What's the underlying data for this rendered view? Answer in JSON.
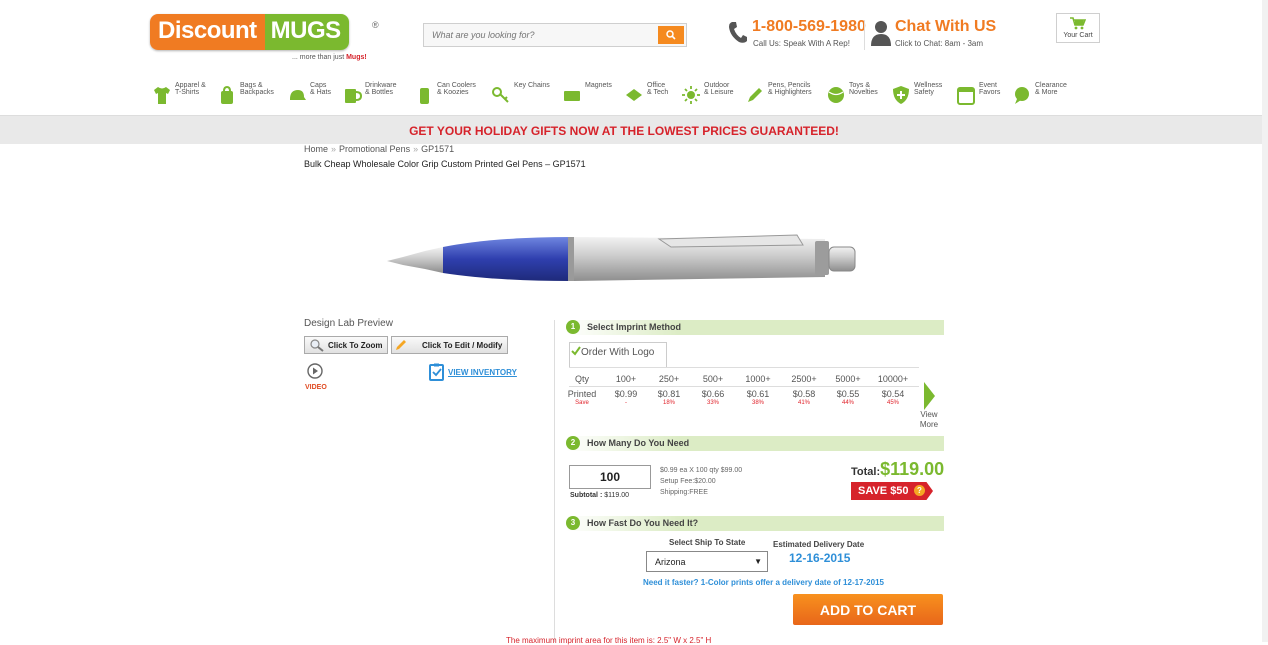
{
  "header": {
    "logo": {
      "part1": "Discount",
      "part2": "MUGS",
      "reg": "®",
      "tagline_prefix": "... more than just ",
      "tagline_emph": "Mugs!"
    },
    "search": {
      "placeholder": "What are you looking for?"
    },
    "phone": {
      "number": "1-800-569-1980",
      "sub": "Call Us: Speak With A Rep!"
    },
    "chat": {
      "title": "Chat With US",
      "sub": "Click to Chat: 8am - 3am"
    },
    "cart": {
      "label": "Your Cart"
    }
  },
  "nav": {
    "items": [
      {
        "label": "Apparel &\nT-Shirts",
        "icon": "tshirt-icon"
      },
      {
        "label": "Bags &\nBackpacks",
        "icon": "bag-icon"
      },
      {
        "label": "Caps\n& Hats",
        "icon": "cap-icon"
      },
      {
        "label": "Drinkware\n& Bottles",
        "icon": "mug-icon"
      },
      {
        "label": "Can Coolers\n& Koozies",
        "icon": "can-icon"
      },
      {
        "label": "Key Chains",
        "icon": "keychain-icon"
      },
      {
        "label": "Magnets",
        "icon": "magnet-icon"
      },
      {
        "label": "Office\n& Tech",
        "icon": "office-icon"
      },
      {
        "label": "Outdoor\n& Leisure",
        "icon": "sun-icon"
      },
      {
        "label": "Pens, Pencils\n& Highlighters",
        "icon": "pen-icon"
      },
      {
        "label": "Toys &\nNovelties",
        "icon": "ball-icon"
      },
      {
        "label": "Wellness\nSafety",
        "icon": "shield-icon"
      },
      {
        "label": "Event\nFavors",
        "icon": "calendar-icon"
      },
      {
        "label": "Clearance\n& More",
        "icon": "chat-bubble-icon"
      }
    ]
  },
  "banner": {
    "text": "GET YOUR HOLIDAY GIFTS NOW AT THE LOWEST PRICES GUARANTEED!"
  },
  "breadcrumb": {
    "home": "Home",
    "category": "Promotional Pens",
    "current": "GP1571"
  },
  "product": {
    "title": "Bulk Cheap Wholesale Color Grip Custom Printed Gel Pens – GP1571"
  },
  "tools": {
    "design_lab": "Design Lab Preview",
    "zoom": "Click To Zoom",
    "edit": "Click To Edit / Modify",
    "video": "VIDEO",
    "inventory": "VIEW INVENTORY"
  },
  "step1": {
    "num": "1",
    "title": "Select Imprint Method",
    "tab": "Order With Logo"
  },
  "pricing": {
    "row_labels": {
      "qty": "Qty",
      "price": "Printed",
      "save": "Save"
    },
    "tiers": [
      {
        "qty": "100+",
        "price": "$0.99",
        "save": "-"
      },
      {
        "qty": "250+",
        "price": "$0.81",
        "save": "18%"
      },
      {
        "qty": "500+",
        "price": "$0.66",
        "save": "33%"
      },
      {
        "qty": "1000+",
        "price": "$0.61",
        "save": "38%"
      },
      {
        "qty": "2500+",
        "price": "$0.58",
        "save": "41%"
      },
      {
        "qty": "5000+",
        "price": "$0.55",
        "save": "44%"
      },
      {
        "qty": "10000+",
        "price": "$0.54",
        "save": "45%"
      }
    ],
    "view_more": "View More"
  },
  "step2": {
    "num": "2",
    "title": "How Many Do You Need",
    "qty": "100",
    "subtotal_label": "Subtotal :",
    "subtotal_value": "$119.00",
    "calc1": "$0.99 ea X 100 qty $99.00",
    "calc2": "Setup Fee:$20.00",
    "calc3": "Shipping:FREE",
    "total_label": "Total:",
    "total_value": "$119.00",
    "save_badge": "SAVE $50",
    "save_q": "?"
  },
  "step3": {
    "num": "3",
    "title": "How Fast Do You Need It?",
    "ship_label": "Select Ship To State",
    "state": "Arizona",
    "est_label": "Estimated Delivery Date",
    "est_date": "12-16-2015",
    "faster": "Need it faster? 1-Color prints offer a delivery date of 12-17-2015"
  },
  "add_to_cart": "ADD TO CART",
  "imprint_note": "The maximum imprint area for this item is: 2.5\" W x 2.5\" H",
  "colors": {
    "orange": "#f07b22",
    "green": "#7bb92f",
    "red": "#d6232b",
    "blue": "#2e8fd8"
  }
}
